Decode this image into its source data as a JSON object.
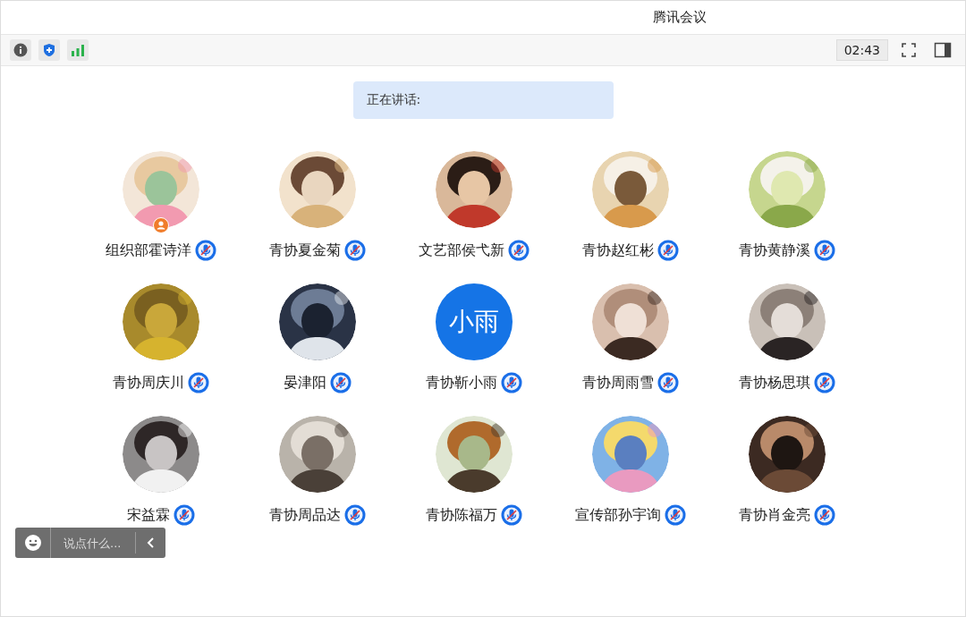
{
  "window": {
    "title": "腾讯会议"
  },
  "toolbar": {
    "timer": "02:43"
  },
  "speaking": {
    "label": "正在讲话:"
  },
  "participants": [
    {
      "name": "组织部霍诗洋",
      "kind": "picture",
      "host": true,
      "muted": true
    },
    {
      "name": "青协夏金菊",
      "kind": "picture",
      "host": false,
      "muted": true
    },
    {
      "name": "文艺部侯弋新",
      "kind": "picture",
      "host": false,
      "muted": true
    },
    {
      "name": "青协赵红彬",
      "kind": "picture",
      "host": false,
      "muted": true
    },
    {
      "name": "青协黄静溪",
      "kind": "picture",
      "host": false,
      "muted": true
    },
    {
      "name": "青协周庆川",
      "kind": "picture",
      "host": false,
      "muted": true
    },
    {
      "name": "晏津阳",
      "kind": "picture",
      "host": false,
      "muted": true
    },
    {
      "name": "青协靳小雨",
      "kind": "text",
      "initials": "小雨",
      "host": false,
      "muted": true
    },
    {
      "name": "青协周雨雪",
      "kind": "picture",
      "host": false,
      "muted": true
    },
    {
      "name": "青协杨思琪",
      "kind": "picture",
      "host": false,
      "muted": true
    },
    {
      "name": "宋益霖",
      "kind": "picture",
      "host": false,
      "muted": true
    },
    {
      "name": "青协周品达",
      "kind": "picture",
      "host": false,
      "muted": true
    },
    {
      "name": "青协陈福万",
      "kind": "picture",
      "host": false,
      "muted": true
    },
    {
      "name": "宣传部孙宇询",
      "kind": "picture",
      "host": false,
      "muted": true
    },
    {
      "name": "青协肖金亮",
      "kind": "picture",
      "host": false,
      "muted": true
    }
  ],
  "chat": {
    "placeholder": "说点什么..."
  }
}
